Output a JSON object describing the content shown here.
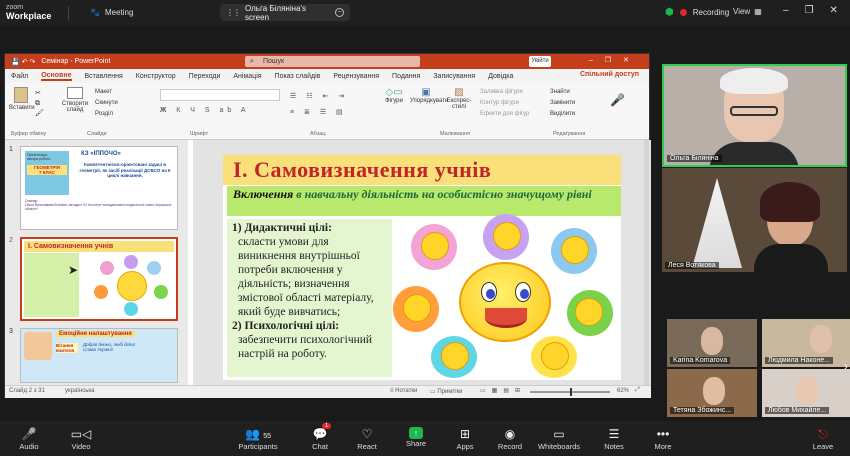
{
  "zoom": {
    "brand_top": "zoom",
    "brand_bottom": "Workplace",
    "meeting_label": "Meeting",
    "screen_share": "Ольга Біляніна's screen",
    "recording": "Recording",
    "view": "View"
  },
  "ppt": {
    "title": "Семінар - PowerPoint",
    "search": "Пошук",
    "login": "Увійти",
    "menu": [
      "Файл",
      "Основне",
      "Вставлення",
      "Конструктор",
      "Переходи",
      "Анімація",
      "Показ слайдів",
      "Рецензування",
      "Подання",
      "Записування",
      "Довідка"
    ],
    "share_access": "Спільний доступ",
    "ribbon": {
      "paste": "Вставити",
      "create_slide": "Створити слайд",
      "layout": "Макет",
      "reset": "Скинути",
      "section": "Розділ",
      "shapes": "Фігури",
      "arrange": "Упорядкувати",
      "styles": "Експрес-стилі",
      "fill": "Заливка фігури",
      "outline": "Контур фігури",
      "effects": "Ефекти для фігур",
      "find": "Знайти",
      "replace": "Замінити",
      "select": "Виділити",
      "g_clipboard": "Буфер обміну",
      "g_slides": "Слайди",
      "g_font": "Шрифт",
      "g_paragraph": "Абзац",
      "g_drawing": "Малювання",
      "g_editing": "Редагування"
    },
    "thumb1": {
      "num": "1",
      "school": "КЗ «ІППОЧО»",
      "left_label": "Презентація\nавтора роботи",
      "subject": "ГЕОМЕТРІЯ\n7 КЛАС",
      "title": "Компетентнісно-орієнтовані задачі в геометрії, як засіб реалізації ДСБСО на ІІ циклі навчання.",
      "author": "Семінар\nОльга Ярославівна Біляніна, методист КЗ «Інститут післядипломної педагогічної освіти Черкаської області»"
    },
    "thumb2": {
      "num": "2",
      "title": "І. Самовизначення учнів"
    },
    "thumb3": {
      "num": "3",
      "title": "Емоційне налаштування",
      "sub": "Вітання вчителя",
      "greet": "Доброї днини, любі діти! Слава Україні!"
    },
    "slide": {
      "title": "І. Самовизначення  учнів",
      "include_bold": "Включення",
      "include_rest": " в навчальну діяльність на особистісно значущому рівні",
      "item1_head": "1)  Дидактичні цілі:",
      "item1_text": "скласти умови для виникнення внутрішньої потреби включення у діяльність; визначення змістової області матеріалу, який буде вивчатись;",
      "item2_head": "2) Психологічні цілі:",
      "item2_text": "забезпечити психологічний настрій на роботу."
    },
    "status": {
      "slide": "Слайд 2 з 31",
      "lang": "українська",
      "notes": "Нотатки",
      "comments": "Примітки",
      "zoom": "62%"
    }
  },
  "participants": [
    {
      "name": "Ольга Біляніна"
    },
    {
      "name": "Леся Вотякова"
    },
    {
      "name": "Karina Komarova"
    },
    {
      "name": "Людмила Наконе..."
    },
    {
      "name": "Тетяна Збожинс..."
    },
    {
      "name": "Любов Михайле..."
    }
  ],
  "toolbar": {
    "audio": "Audio",
    "video": "Video",
    "participants": "Participants",
    "participants_count": "55",
    "chat": "Chat",
    "chat_badge": "1",
    "react": "React",
    "share": "Share",
    "apps": "Apps",
    "record": "Record",
    "whiteboards": "Whiteboards",
    "notes": "Notes",
    "more": "More",
    "leave": "Leave"
  },
  "colors": {
    "ppt_accent": "#c43e1c",
    "slide_title_bg": "#f9e07a",
    "slide_title_text": "#c0252e",
    "slide_green": "#b8e86c",
    "share_green": "#1cb94f",
    "leave_red": "#e02828"
  }
}
